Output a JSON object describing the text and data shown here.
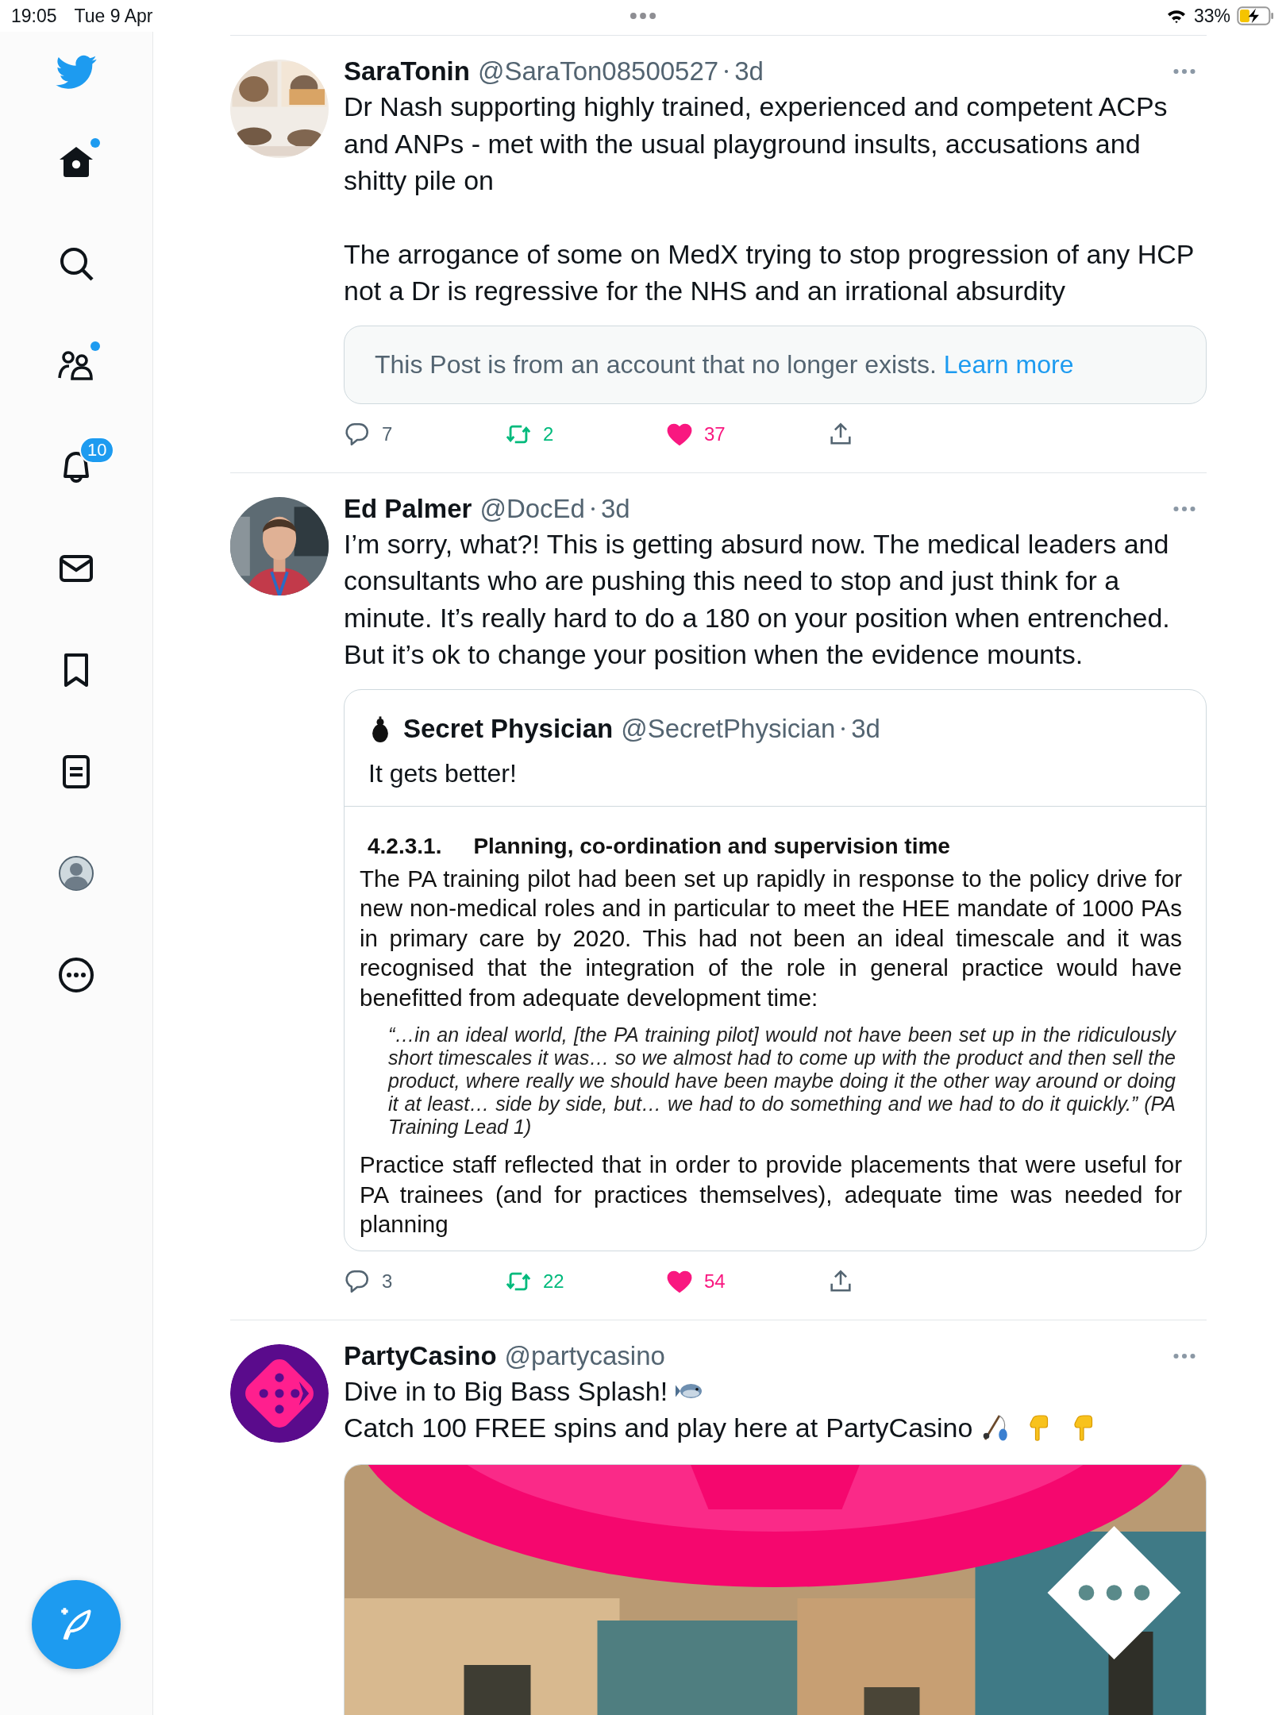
{
  "status_bar": {
    "time": "19:05",
    "date": "Tue 9 Apr",
    "battery": "33%"
  },
  "sidebar": {
    "items": [
      {
        "unread": true
      },
      {
        "unread": false
      },
      {
        "unread": true
      },
      {
        "unread": false,
        "badge": "10"
      },
      {
        "unread": false
      },
      {
        "unread": false
      },
      {
        "unread": false
      },
      {
        "unread": false
      },
      {
        "unread": false
      }
    ]
  },
  "tweets": [
    {
      "author": "SaraTonin",
      "handle": "@SaraTon08500527",
      "time": "3d",
      "avatar": {
        "kind": "picture"
      },
      "body": [
        [
          {
            "kind": "text",
            "text": "Dr Nash supporting highly trained, experienced and competent ACPs and ANPs - met with the usual playground insults, accusations and shitty pile on"
          }
        ],
        [
          {
            "kind": "text",
            "text": "The arrogance of some on MedX trying to stop progression of any HCP not a Dr is regressive for the NHS and an irrational absurdity"
          }
        ]
      ],
      "notice": {
        "text": "This Post is from an account that no longer exists.",
        "link": "Learn more"
      },
      "actions": {
        "replies": "7",
        "reposts": "2",
        "likes": "37",
        "reposted": true,
        "liked": true
      }
    },
    {
      "author": "Ed Palmer",
      "handle": "@DocEd",
      "time": "3d",
      "avatar": {
        "kind": "picture"
      },
      "body": [
        [
          {
            "kind": "text",
            "text": "I’m sorry, what?! This is getting absurd now. The medical leaders and consultants who are pushing this need to stop and just think for a minute. It’s really hard to do a 180 on your position when entrenched. But it’s ok to change your position when the evidence mounts."
          }
        ]
      ],
      "quote": {
        "author": "Secret Physician",
        "handle": "@SecretPhysician",
        "time": "3d",
        "text": "It gets better!",
        "document": [
          {
            "kind": "heading",
            "number": "4.2.3.1.",
            "text": "Planning, co-ordination and supervision time"
          },
          {
            "kind": "paragraph",
            "text": "The PA training pilot had been set up rapidly in response to the policy drive for new non-medical roles and in particular to meet the HEE mandate of 1000 PAs in primary care by 2020. This had not been an ideal timescale and it was recognised that the integration of the role in general practice would have benefitted from adequate development time:"
          },
          {
            "kind": "quote",
            "text": "“…in an ideal world, [the PA training pilot] would not have been set up in the ridiculously short timescales it was… so we almost had to come up with the product and then sell the product, where really we should have been maybe doing it the other way around or doing it at least… side by side, but… we had to do something and we had to do it quickly.” (PA Training Lead 1)"
          },
          {
            "kind": "paragraph",
            "text": "Practice staff reflected that in order to provide placements that were useful for PA trainees (and for practices themselves), adequate time was needed for planning"
          }
        ]
      },
      "actions": {
        "replies": "3",
        "reposts": "22",
        "likes": "54",
        "reposted": true,
        "liked": true
      }
    },
    {
      "author": "PartyCasino",
      "handle": "@partycasino",
      "avatar": {
        "kind": "logo"
      },
      "body": [
        [
          {
            "kind": "text",
            "text": "Dive in to Big Bass Splash!"
          },
          {
            "kind": "fish"
          },
          {
            "kind": "text",
            "text": "Catch 100 FREE spins and play here at"
          },
          {
            "kind": "text",
            "text": "PartyCasino"
          },
          {
            "kind": "fishing"
          },
          {
            "kind": "pointing"
          },
          {
            "kind": "pointing"
          }
        ]
      ],
      "media": {
        "kind": "picture"
      }
    }
  ]
}
